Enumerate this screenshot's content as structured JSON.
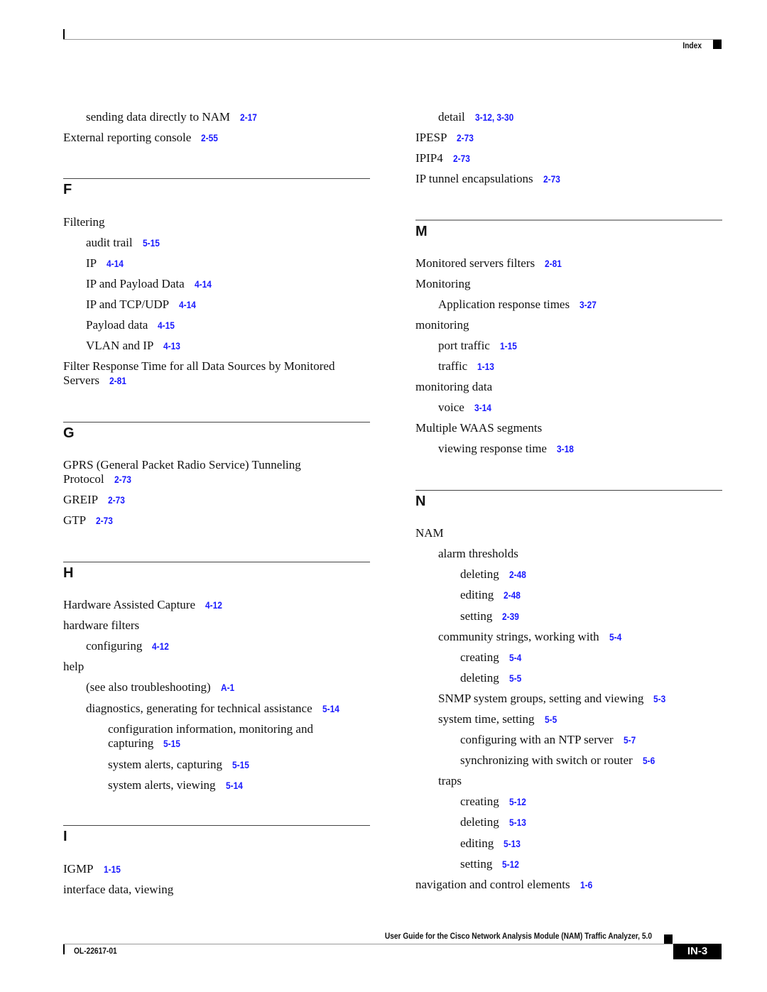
{
  "header": {
    "section_label": "Index"
  },
  "footer": {
    "book_title": "User Guide for the Cisco Network Analysis Module (NAM) Traffic Analyzer, 5.0",
    "doc_number": "OL-22617-01",
    "page_number": "IN-3"
  },
  "left_column": {
    "continued": [
      {
        "text": "sending data directly to NAM",
        "ref": "2-17"
      },
      {
        "text": "External reporting console",
        "ref": "2-55"
      }
    ],
    "sections": {
      "F": {
        "letter": "F",
        "entries": [
          {
            "text": "Filtering",
            "ref": ""
          },
          {
            "text": "audit trail",
            "ref": "5-15"
          },
          {
            "text": "IP",
            "ref": "4-14"
          },
          {
            "text": "IP and Payload Data",
            "ref": "4-14"
          },
          {
            "text": "IP and TCP/UDP",
            "ref": "4-14"
          },
          {
            "text": "Payload data",
            "ref": "4-15"
          },
          {
            "text": "VLAN and IP",
            "ref": "4-13"
          },
          {
            "text": "Filter Response Time for all Data Sources by Monitored Servers",
            "ref": "2-81"
          }
        ]
      },
      "G": {
        "letter": "G",
        "entries": [
          {
            "text": "GPRS (General Packet Radio Service) Tunneling Protocol",
            "ref": "2-73"
          },
          {
            "text": "GREIP",
            "ref": "2-73"
          },
          {
            "text": "GTP",
            "ref": "2-73"
          }
        ]
      },
      "H": {
        "letter": "H",
        "entries": [
          {
            "text": "Hardware Assisted Capture",
            "ref": "4-12"
          },
          {
            "text": "hardware filters",
            "ref": ""
          },
          {
            "text": "configuring",
            "ref": "4-12"
          },
          {
            "text": "help",
            "ref": ""
          },
          {
            "text": "(see also troubleshooting)",
            "ref": "A-1"
          },
          {
            "text": "diagnostics, generating for technical assistance",
            "ref": "5-14"
          },
          {
            "text": "configuration information, monitoring and capturing",
            "ref": "5-15"
          },
          {
            "text": "system alerts, capturing",
            "ref": "5-15"
          },
          {
            "text": "system alerts, viewing",
            "ref": "5-14"
          }
        ]
      },
      "I": {
        "letter": "I",
        "entries": [
          {
            "text": "IGMP",
            "ref": "1-15"
          },
          {
            "text": "interface data, viewing",
            "ref": ""
          }
        ]
      }
    }
  },
  "right_column": {
    "continued": [
      {
        "text": "detail",
        "ref": "3-12, 3-30"
      },
      {
        "text": "IPESP",
        "ref": "2-73"
      },
      {
        "text": "IPIP4",
        "ref": "2-73"
      },
      {
        "text": "IP tunnel encapsulations",
        "ref": "2-73"
      }
    ],
    "sections": {
      "M": {
        "letter": "M",
        "entries": [
          {
            "text": "Monitored servers filters",
            "ref": "2-81"
          },
          {
            "text": "Monitoring",
            "ref": ""
          },
          {
            "text": "Application response times",
            "ref": "3-27"
          },
          {
            "text": "monitoring",
            "ref": ""
          },
          {
            "text": "port traffic",
            "ref": "1-15"
          },
          {
            "text": "traffic",
            "ref": "1-13"
          },
          {
            "text": "monitoring data",
            "ref": ""
          },
          {
            "text": "voice",
            "ref": "3-14"
          },
          {
            "text": "Multiple WAAS segments",
            "ref": ""
          },
          {
            "text": "viewing response time",
            "ref": "3-18"
          }
        ]
      },
      "N": {
        "letter": "N",
        "entries": [
          {
            "text": "NAM",
            "ref": ""
          },
          {
            "text": "alarm thresholds",
            "ref": ""
          },
          {
            "text": "deleting",
            "ref": "2-48"
          },
          {
            "text": "editing",
            "ref": "2-48"
          },
          {
            "text": "setting",
            "ref": "2-39"
          },
          {
            "text": "community strings, working with",
            "ref": "5-4"
          },
          {
            "text": "creating",
            "ref": "5-4"
          },
          {
            "text": "deleting",
            "ref": "5-5"
          },
          {
            "text": "SNMP system groups, setting and viewing",
            "ref": "5-3"
          },
          {
            "text": "system time, setting",
            "ref": "5-5"
          },
          {
            "text": "configuring with an NTP server",
            "ref": "5-7"
          },
          {
            "text": "synchronizing with switch or router",
            "ref": "5-6"
          },
          {
            "text": "traps",
            "ref": ""
          },
          {
            "text": "creating",
            "ref": "5-12"
          },
          {
            "text": "deleting",
            "ref": "5-13"
          },
          {
            "text": "editing",
            "ref": "5-13"
          },
          {
            "text": "setting",
            "ref": "5-12"
          },
          {
            "text": "navigation and control elements",
            "ref": "1-6"
          }
        ]
      }
    }
  }
}
